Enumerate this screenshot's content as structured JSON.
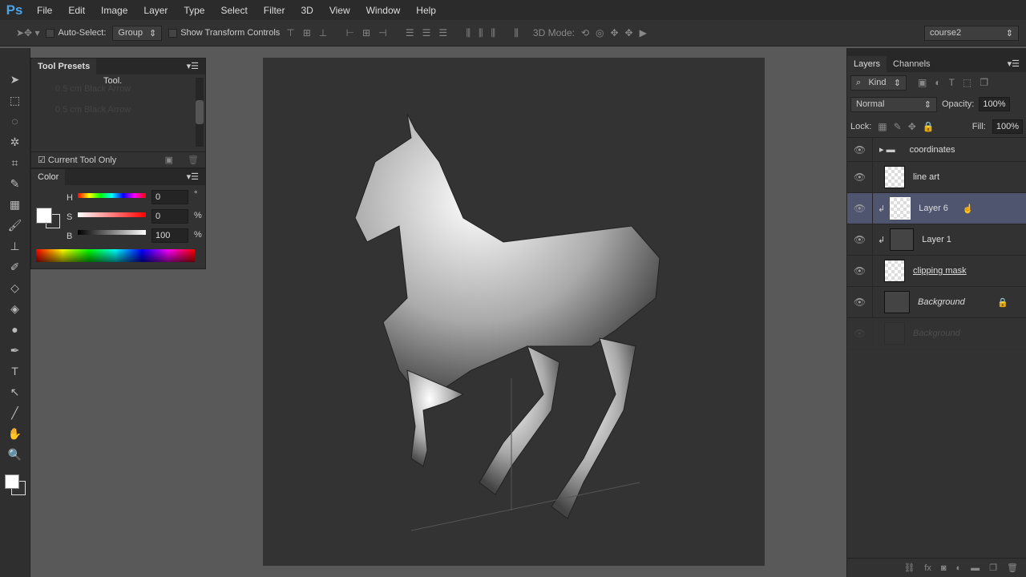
{
  "app": {
    "logo": "Ps"
  },
  "menu": [
    "File",
    "Edit",
    "Image",
    "Layer",
    "Type",
    "Select",
    "Filter",
    "3D",
    "View",
    "Window",
    "Help"
  ],
  "options": {
    "auto_select": "Auto-Select:",
    "group": "Group",
    "show_transform": "Show Transform Controls",
    "mode_3d": "3D Mode:",
    "workspace": "course2"
  },
  "tool_presets": {
    "title": "Tool Presets",
    "tooltip": "Tool.",
    "items": [
      "0.5 cm Black Arrow",
      "0.5 cm Black Arrow"
    ],
    "current_tool_only": "Current Tool Only"
  },
  "color": {
    "title": "Color",
    "h_label": "H",
    "h": "0",
    "h_unit": "°",
    "s_label": "S",
    "s": "0",
    "s_unit": "%",
    "b_label": "B",
    "b": "100",
    "b_unit": "%"
  },
  "layers_panel": {
    "tabs": [
      "Layers",
      "Channels"
    ],
    "filter": "Kind",
    "blend": "Normal",
    "opacity_label": "Opacity:",
    "opacity": "100%",
    "lock_label": "Lock:",
    "fill_label": "Fill:",
    "fill": "100%",
    "layers": [
      {
        "name": "coordinates",
        "type": "group"
      },
      {
        "name": "line art"
      },
      {
        "name": "Layer 6",
        "selected": true,
        "clipped": true
      },
      {
        "name": "Layer 1",
        "clipped": true
      },
      {
        "name": "clipping mask"
      },
      {
        "name": "Background",
        "locked": true
      },
      {
        "name": "Background",
        "ghost": true
      }
    ]
  },
  "colors": {
    "accent": "#4aa3e8",
    "selected_layer": "#4f556e"
  }
}
